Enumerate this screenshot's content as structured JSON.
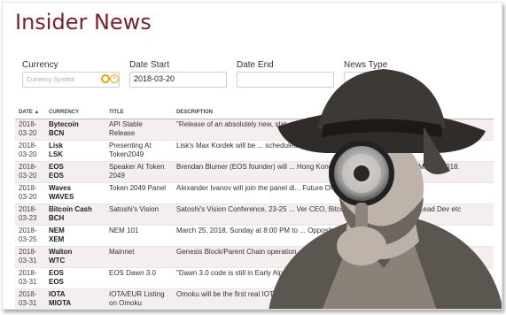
{
  "page_title": "Insider News",
  "filters": {
    "currency_label": "Currency",
    "currency_placeholder": "Currency Symbol",
    "date_start_label": "Date Start",
    "date_start_value": "2018-03-20",
    "date_end_label": "Date End",
    "date_end_value": "",
    "news_type_label": "News Type",
    "news_type_value": "News ▾"
  },
  "table": {
    "headers": [
      "DATE ▲",
      "CURRENCY",
      "TITLE",
      "DESCRIPTION"
    ],
    "rows": [
      {
        "date1": "2018-",
        "date2": "03-20",
        "coin": "Bytecoin",
        "sym": "BCN",
        "title": "API Stable Release",
        "desc": "\"Release of an absolutely new, stat... a fast synchronized blockchain for Bytecoin users.\""
      },
      {
        "date1": "2018-",
        "date2": "03-20",
        "coin": "Lisk",
        "sym": "LSK",
        "title": "Presenting At Token2049",
        "desc": "Lisk's Max Kordek will be ... scheduled for 20th-21st of March, 2018."
      },
      {
        "date1": "2018-",
        "date2": "03-20",
        "coin": "EOS",
        "sym": "EOS",
        "title": "Speaker At Token 2049",
        "desc": "Brendan Blumer (EOS founder) will ... Hong Kong scheduled for 20th-21st of March, 2018."
      },
      {
        "date1": "2018-",
        "date2": "03-20",
        "coin": "Waves",
        "sym": "WAVES",
        "title": "Token 2049 Panel",
        "desc": "Alexander Ivanov will join the panel di... Future Of Crypto Trading?\""
      },
      {
        "date1": "2018-",
        "date2": "03-23",
        "coin": "Bitcoin Cash",
        "sym": "BCH",
        "title": "Satoshi's Vision",
        "desc": "Satoshi's Vision Conference, 23-25 ... Ver CEO, Bitcoin.com Amaury Séchet, Lead Dev etc"
      },
      {
        "date1": "2018-",
        "date2": "03-25",
        "coin": "NEM",
        "sym": "XEM",
        "title": "NEM 101",
        "desc": "March 25, 2018, Sunday at 8:00 PM to ... Opposite Deira City Centre, Dubai."
      },
      {
        "date1": "2018-",
        "date2": "03-31",
        "coin": "Walton",
        "sym": "WTC",
        "title": "Mainnet",
        "desc": "Genesis Block/Parent Chain operation..."
      },
      {
        "date1": "2018-",
        "date2": "03-31",
        "coin": "EOS",
        "sym": "EOS",
        "title": "EOS Dawn 3.0",
        "desc": "\"Dawn 3.0 code is still in Early Alpha [... 2018\""
      },
      {
        "date1": "2018-",
        "date2": "03-31",
        "coin": "IOTA",
        "sym": "MIOTA",
        "title": "IOTA/EUR Listing on Omoku",
        "desc": "Omoku will be the first real IOTA/EUR br..."
      }
    ]
  }
}
